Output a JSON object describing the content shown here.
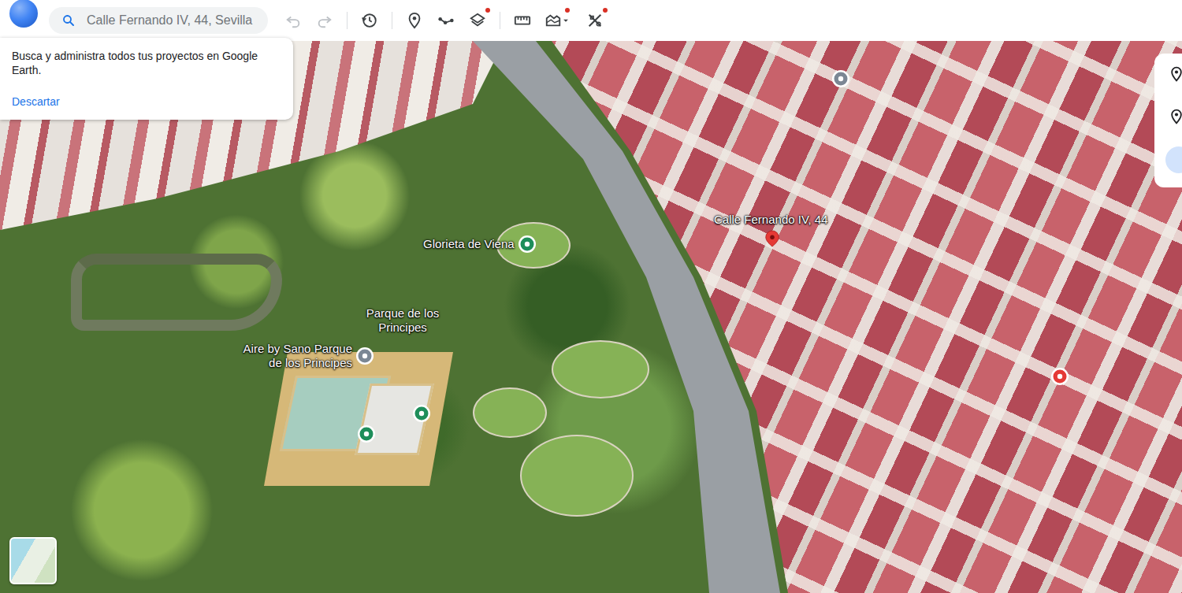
{
  "search": {
    "value": "Calle Fernando IV, 44, Sevilla"
  },
  "toolbar": [
    {
      "disabled": true,
      "badge": false
    },
    {
      "disabled": true,
      "badge": false
    },
    {
      "disabled": false,
      "badge": false
    },
    {
      "disabled": false,
      "badge": false
    },
    {
      "disabled": false,
      "badge": false
    },
    {
      "disabled": false,
      "badge": true
    },
    {
      "disabled": false,
      "badge": false
    },
    {
      "disabled": false,
      "badge": true
    },
    {
      "disabled": false,
      "badge": true
    }
  ],
  "popup": {
    "text": "Busca y administra todos tus proyectos en Google Earth.",
    "action": "Descartar"
  },
  "map": {
    "places": [
      {
        "label": "Calle Fernando IV, 44",
        "kind": "marker",
        "color": "#e53935"
      },
      {
        "label": "Glorieta de Viena",
        "kind": "badge",
        "color": "#1e8e5a"
      },
      {
        "label": "Parque de los Principes",
        "kind": "text",
        "color": "#ffffff"
      },
      {
        "label": "Aire by Sano Parque de los Principes",
        "kind": "badge",
        "color": "#7b8794"
      },
      {
        "label": "",
        "kind": "badge",
        "color": "#1e8e5a"
      },
      {
        "label": "",
        "kind": "badge",
        "color": "#1e8e5a"
      },
      {
        "label": "",
        "kind": "badge",
        "color": "#7b8794"
      },
      {
        "label": "",
        "kind": "badge",
        "color": "#e53935"
      }
    ]
  }
}
